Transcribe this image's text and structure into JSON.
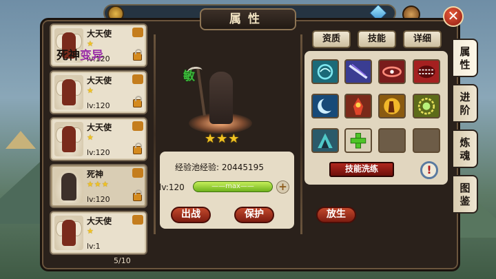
{
  "window": {
    "title": "属性",
    "close_label": "✕"
  },
  "hero_list": {
    "page_count": "5/10",
    "items": [
      {
        "name": "大天使",
        "stars": "★",
        "level": "lv:120",
        "type": "angel",
        "locked": true
      },
      {
        "name": "大天使",
        "stars": "★",
        "level": "lv:120",
        "type": "angel",
        "locked": true
      },
      {
        "name": "大天使",
        "stars": "★",
        "level": "lv:120",
        "type": "angel",
        "locked": true
      },
      {
        "name": "死神",
        "stars": "★★★",
        "level": "lv:120",
        "type": "reaper",
        "locked": true,
        "selected": true
      },
      {
        "name": "大天使",
        "stars": "★",
        "level": "lv:1",
        "type": "angel",
        "locked": false
      }
    ]
  },
  "hero_detail": {
    "name_main": "死神",
    "name_suffix": "变异",
    "class_char": "敏",
    "stars": "★★★",
    "exp_label": "经验池经验:",
    "exp_value": "20445195",
    "level_label": "lv:120",
    "level_bar_text": "——max——",
    "level_progress": 1.0,
    "add_label": "+",
    "deploy_label": "出战",
    "protect_label": "保护",
    "release_label": "放生"
  },
  "tabs": [
    "资质",
    "技能",
    "详细"
  ],
  "skills": {
    "wash_label": "技能洗练",
    "info_label": "!",
    "slots": [
      {
        "icon": "cyan-swirl-icon",
        "color": "#1b6a78"
      },
      {
        "icon": "purple-blade-icon",
        "color": "#3a3d92"
      },
      {
        "icon": "red-ring-icon",
        "color": "#7a1c1c"
      },
      {
        "icon": "red-jaws-icon",
        "color": "#a52020"
      },
      {
        "icon": "blue-crescent-icon",
        "color": "#184a78"
      },
      {
        "icon": "demon-fire-icon",
        "color": "#7a2a1a"
      },
      {
        "icon": "gold-fighter-icon",
        "color": "#8a5a10"
      },
      {
        "icon": "green-sun-icon",
        "color": "#5d6b1a"
      },
      {
        "icon": "teal-warrior-icon",
        "color": "#2a5a6a"
      },
      {
        "icon": "add-skill-icon",
        "color": "#5a8a1a"
      },
      {
        "icon": "empty-slot",
        "color": "#6d5c47"
      },
      {
        "icon": "empty-slot",
        "color": "#6d5c47"
      }
    ]
  },
  "side_tabs": [
    "属性",
    "进阶",
    "炼魂",
    "图鉴"
  ]
}
